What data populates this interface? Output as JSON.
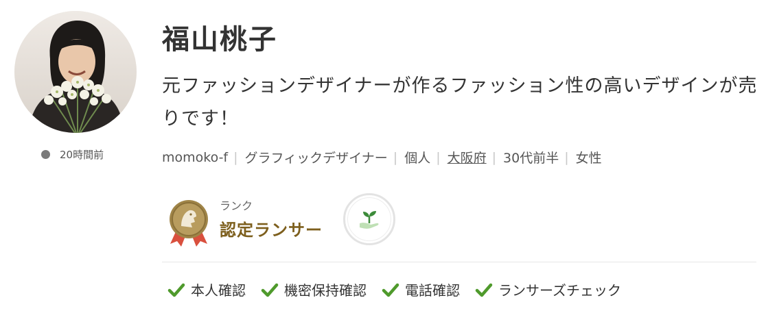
{
  "profile": {
    "name": "福山桃子",
    "catchphrase": "元ファッションデザイナーが作るファッション性の高いデザインが売りです！",
    "last_active": "20時間前",
    "meta": {
      "username": "momoko-f",
      "occupation": "グラフィックデザイナー",
      "type": "個人",
      "location": "大阪府",
      "age": "30代前半",
      "gender": "女性"
    }
  },
  "rank": {
    "label": "ランク",
    "value": "認定ランサー",
    "medal_icon": "medal-icon",
    "badge_icon": "sprout-hand-icon"
  },
  "verifications": [
    {
      "label": "本人確認"
    },
    {
      "label": "機密保持確認"
    },
    {
      "label": "電話確認"
    },
    {
      "label": "ランサーズチェック"
    }
  ],
  "colors": {
    "check": "#4f9a2c",
    "rank": "#7d5f1d",
    "medal": "#a08548",
    "ribbon": "#d9503e"
  }
}
